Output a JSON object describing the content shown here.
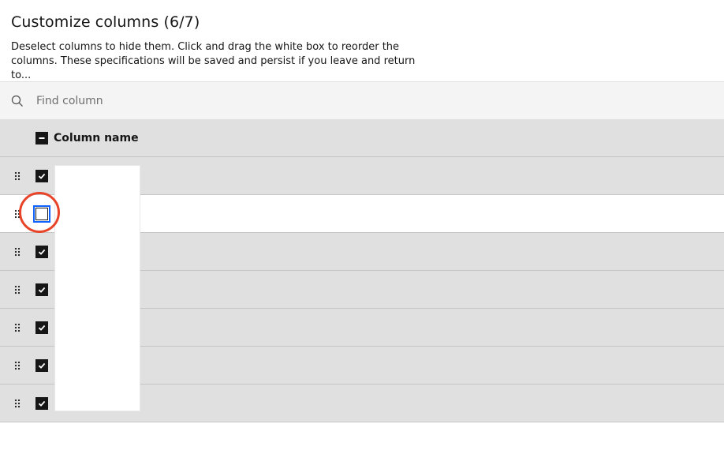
{
  "modal": {
    "title": "Customize columns (6/7)",
    "description": "Deselect columns to hide them. Click and drag the white box to reorder the columns. These specifications will be saved and persist if you leave and return to..."
  },
  "search": {
    "placeholder": "Find column",
    "value": ""
  },
  "table": {
    "header_label": "Column name",
    "header_checkbox_state": "indeterminate",
    "rows": [
      {
        "checked": true,
        "label": ""
      },
      {
        "checked": false,
        "label": ""
      },
      {
        "checked": true,
        "label": ""
      },
      {
        "checked": true,
        "label": ""
      },
      {
        "checked": true,
        "label": ""
      },
      {
        "checked": true,
        "label": ""
      },
      {
        "checked": true,
        "label": ""
      }
    ]
  },
  "colors": {
    "row_bg": "#e0e0e0",
    "checkbox": "#161616",
    "focus": "#0f62fe",
    "highlight_ring": "#e8442a"
  },
  "icons": {
    "search": "search-icon",
    "drag": "drag-handle-icon",
    "check": "checkmark-icon",
    "indeterminate": "minus-icon"
  }
}
